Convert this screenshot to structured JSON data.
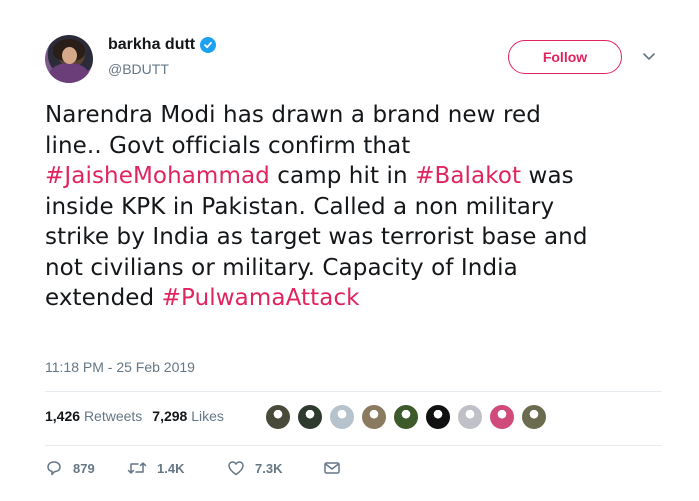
{
  "user": {
    "display_name": "barkha dutt",
    "handle": "@BDUTT",
    "verified": true
  },
  "follow_label": "Follow",
  "tweet": {
    "line1": "Narendra Modi has drawn a brand new red",
    "line2": "line.. Govt officials confirm that",
    "line3_tag1": "#JaisheMohammad",
    "line3_mid": " camp hit in ",
    "line3_tag2": "#Balakot",
    "line3_end": " was",
    "line4": "inside KPK in Pakistan. Called a non military",
    "line5": "strike by India as target was terrorist base and",
    "line6": "not civilians or military. Capacity of India",
    "line7_start": "extended ",
    "line7_tag": "#PulwamaAttack"
  },
  "timestamp": "11:18 PM - 25 Feb 2019",
  "stats": {
    "retweets_count": "1,426",
    "retweets_label": "Retweets",
    "likes_count": "7,298",
    "likes_label": "Likes"
  },
  "liker_colors": [
    "#4a4a3a",
    "#2e3a2e",
    "#b6c3cc",
    "#8a7a60",
    "#3d5a2a",
    "#111111",
    "#c0c0c8",
    "#d04a7a",
    "#6b6b50"
  ],
  "actions": {
    "reply_count": "879",
    "retweet_count": "1.4K",
    "like_count": "7.3K"
  },
  "colors": {
    "accent": "#e0245e",
    "verified_blue": "#1da1f2",
    "secondary_text": "#657786"
  },
  "icons": [
    "verified-badge-icon",
    "chevron-down-icon",
    "reply-icon",
    "retweet-icon",
    "like-icon",
    "message-icon"
  ]
}
